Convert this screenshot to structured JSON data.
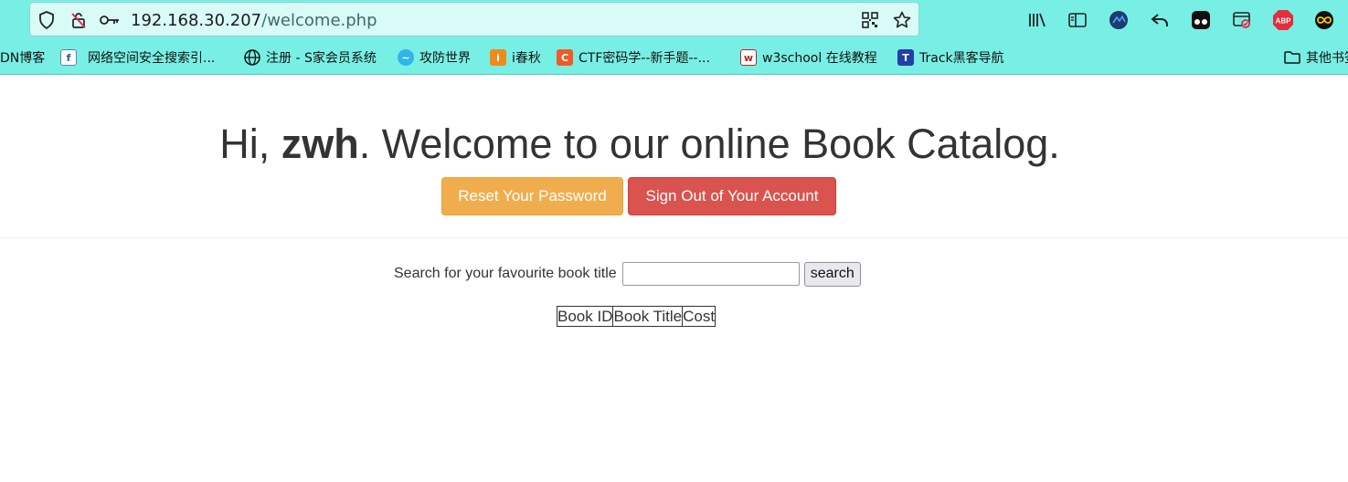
{
  "browser": {
    "url_host": "192.168.30.207",
    "url_path": "/welcome.php",
    "bookmarks": [
      "DN博客",
      "网络空间安全搜索引...",
      "注册 - S家会员系统",
      "攻防世界",
      "i春秋",
      "CTF密码学--新手题--...",
      "w3school 在线教程",
      "Track黑客导航",
      "其他书签"
    ],
    "abp_label": "ABP"
  },
  "page": {
    "greeting_prefix": "Hi, ",
    "username": "zwh",
    "greeting_suffix": ". Welcome to our online Book Catalog.",
    "reset_button": "Reset Your Password",
    "signout_button": "Sign Out of Your Account",
    "search_label": "Search for your favourite book title",
    "search_value": "",
    "search_button": "search",
    "table_headers": [
      "Book ID",
      "Book Title",
      "Cost"
    ]
  },
  "colors": {
    "chrome": "#78efe4",
    "warning": "#f0ad4e",
    "danger": "#d9534f"
  }
}
